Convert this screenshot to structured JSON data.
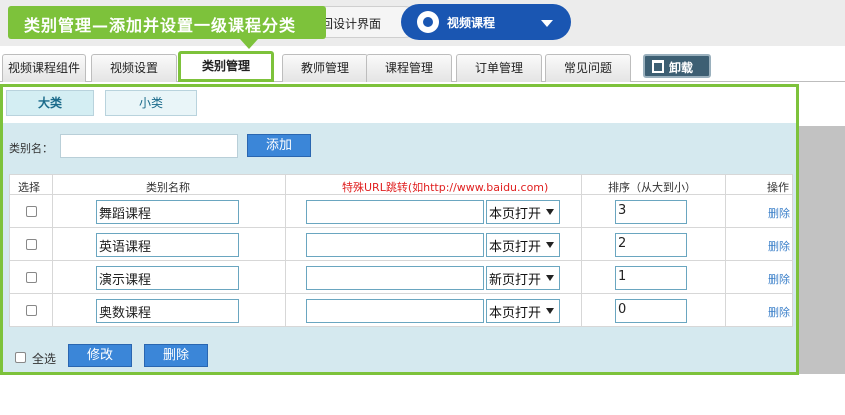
{
  "callout": {
    "text": "类别管理—添加并设置一级课程分类"
  },
  "header": {
    "back_label": "返回设计界面",
    "course_select_label": "视频课程"
  },
  "tabs": [
    {
      "label": "视频课程组件"
    },
    {
      "label": "视频设置"
    },
    {
      "label": "类别管理",
      "active": true
    },
    {
      "label": "教师管理"
    },
    {
      "label": "课程管理"
    },
    {
      "label": "订单管理"
    },
    {
      "label": "常见问题"
    }
  ],
  "uninstall_label": "卸载",
  "subtabs": {
    "major": "大类",
    "minor": "小类"
  },
  "form": {
    "name_label": "类别名：",
    "name_value": "",
    "add_label": "添加"
  },
  "table": {
    "headers": {
      "select": "选择",
      "name": "类别名称",
      "url": "特殊URL跳转(如http://www.baidu.com)",
      "sort": "排序（从大到小）",
      "action": "操作"
    },
    "rows": [
      {
        "name": "舞蹈课程",
        "url": "",
        "open": "本页打开",
        "sort": "3",
        "action": "删除"
      },
      {
        "name": "英语课程",
        "url": "",
        "open": "本页打开",
        "sort": "2",
        "action": "删除"
      },
      {
        "name": "演示课程",
        "url": "",
        "open": "新页打开",
        "sort": "1",
        "action": "删除"
      },
      {
        "name": "奥数课程",
        "url": "",
        "open": "本页打开",
        "sort": "0",
        "action": "删除"
      }
    ]
  },
  "footer": {
    "select_all": "全选",
    "edit": "修改",
    "delete": "删除"
  },
  "colors": {
    "accent_green": "#7dc23b",
    "button_blue": "#3b86d8",
    "header_blue": "#1a56b2",
    "panel_bg": "#d5e9ef"
  }
}
